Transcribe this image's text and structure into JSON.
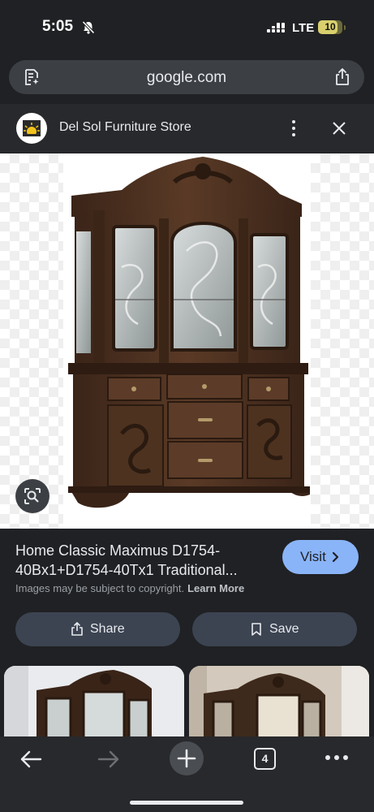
{
  "status_bar": {
    "time": "5:05",
    "network": "LTE",
    "battery": "10"
  },
  "address_bar": {
    "url": "google.com"
  },
  "header": {
    "site_name": "Del Sol Furniture Store"
  },
  "result": {
    "title": "Home Classic Maximus D1754-40Bx1+D1754-40Tx1 Traditional...",
    "visit_label": "Visit",
    "copyright_text": "Images may be subject to copyright.",
    "learn_more_label": "Learn More",
    "share_label": "Share",
    "save_label": "Save"
  },
  "bottom_bar": {
    "tab_count": "4"
  },
  "colors": {
    "background": "#202124",
    "accent": "#8ab4f8",
    "pill": "#3c4452",
    "wood": "#4a3020"
  }
}
